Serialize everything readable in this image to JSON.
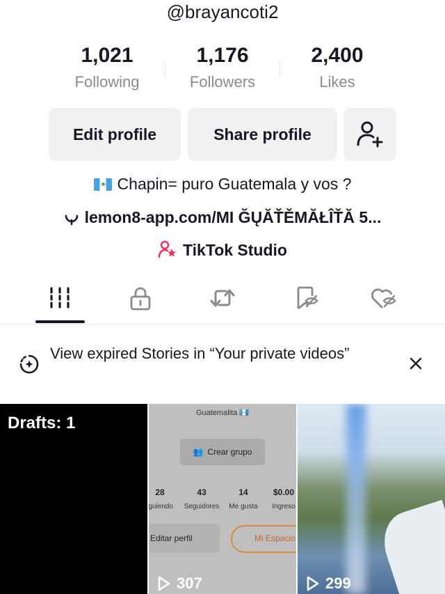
{
  "profile": {
    "username": "@brayancoti2",
    "stats": [
      {
        "value": "1,021",
        "label": "Following"
      },
      {
        "value": "1,176",
        "label": "Followers"
      },
      {
        "value": "2,400",
        "label": "Likes"
      }
    ]
  },
  "buttons": {
    "edit_profile": "Edit profile",
    "share_profile": "Share profile",
    "add_friend_icon": "person-plus-icon"
  },
  "bio": {
    "text": "Chapin= puro Guatemala y vos ?",
    "link": "lemon8-app.com/MI ĞŲĂŤĚMĂŁÎŤĂ 5...",
    "studio": "TikTok Studio"
  },
  "tabs": [
    {
      "icon": "videos-grid-icon",
      "selected": true
    },
    {
      "icon": "lock-icon"
    },
    {
      "icon": "repost-icon"
    },
    {
      "icon": "favorites-icon"
    },
    {
      "icon": "liked-hidden-icon"
    }
  ],
  "notice": {
    "text": "View expired Stories in “Your private videos”"
  },
  "grid": {
    "drafts_label": "Drafts: 1",
    "videos": [
      {
        "views": "307"
      },
      {
        "views": "299"
      }
    ],
    "thumbnail_screenshot": {
      "title": "Guatemalita 🇬🇹",
      "group_button": "Crear grupo",
      "stats": [
        {
          "n": "28",
          "l": "iguiendo"
        },
        {
          "n": "43",
          "l": "Seguidores"
        },
        {
          "n": "14",
          "l": "Me gusta"
        },
        {
          "n": "$0.00",
          "l": "Ingreso"
        }
      ],
      "edit": "Editar perfil",
      "space": "Mi Espacio"
    }
  },
  "colors": {
    "text": "#161823",
    "secondary_text": "#8a8b91",
    "button_bg": "#f1f1f2",
    "studio_pink": "#fe2c55"
  }
}
